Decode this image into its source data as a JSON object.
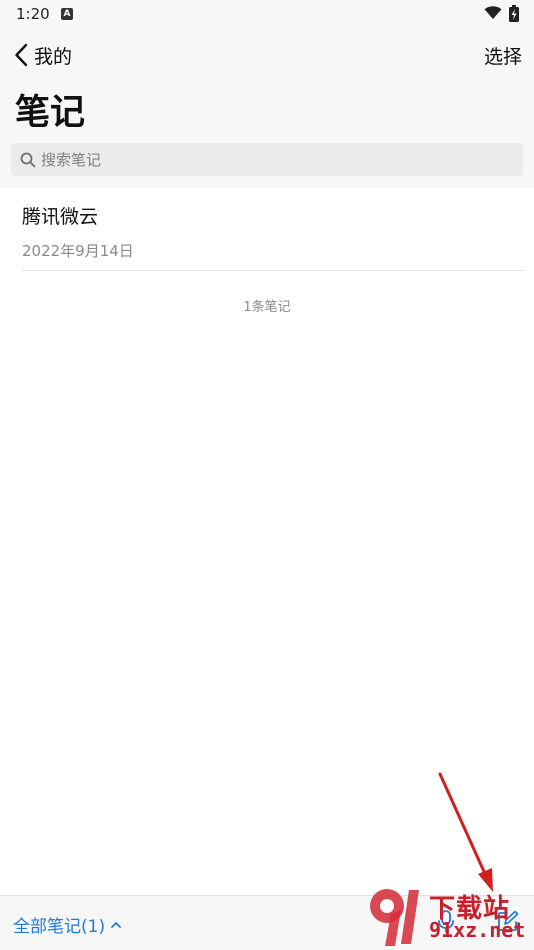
{
  "status_bar": {
    "time": "1:20",
    "notification_icon": "A"
  },
  "header": {
    "back_label": "我的",
    "select_label": "选择",
    "title": "笔记"
  },
  "search": {
    "placeholder": "搜索笔记"
  },
  "notes": [
    {
      "title": "腾讯微云",
      "date": "2022年9月14日"
    }
  ],
  "note_count": "1条笔记",
  "bottom_bar": {
    "folder_label": "全部笔记(1)"
  },
  "watermark": {
    "text": "下载站",
    "url": "91xz.net"
  },
  "colors": {
    "accent": "#1f7ad7",
    "arrow": "#d11f1f"
  }
}
